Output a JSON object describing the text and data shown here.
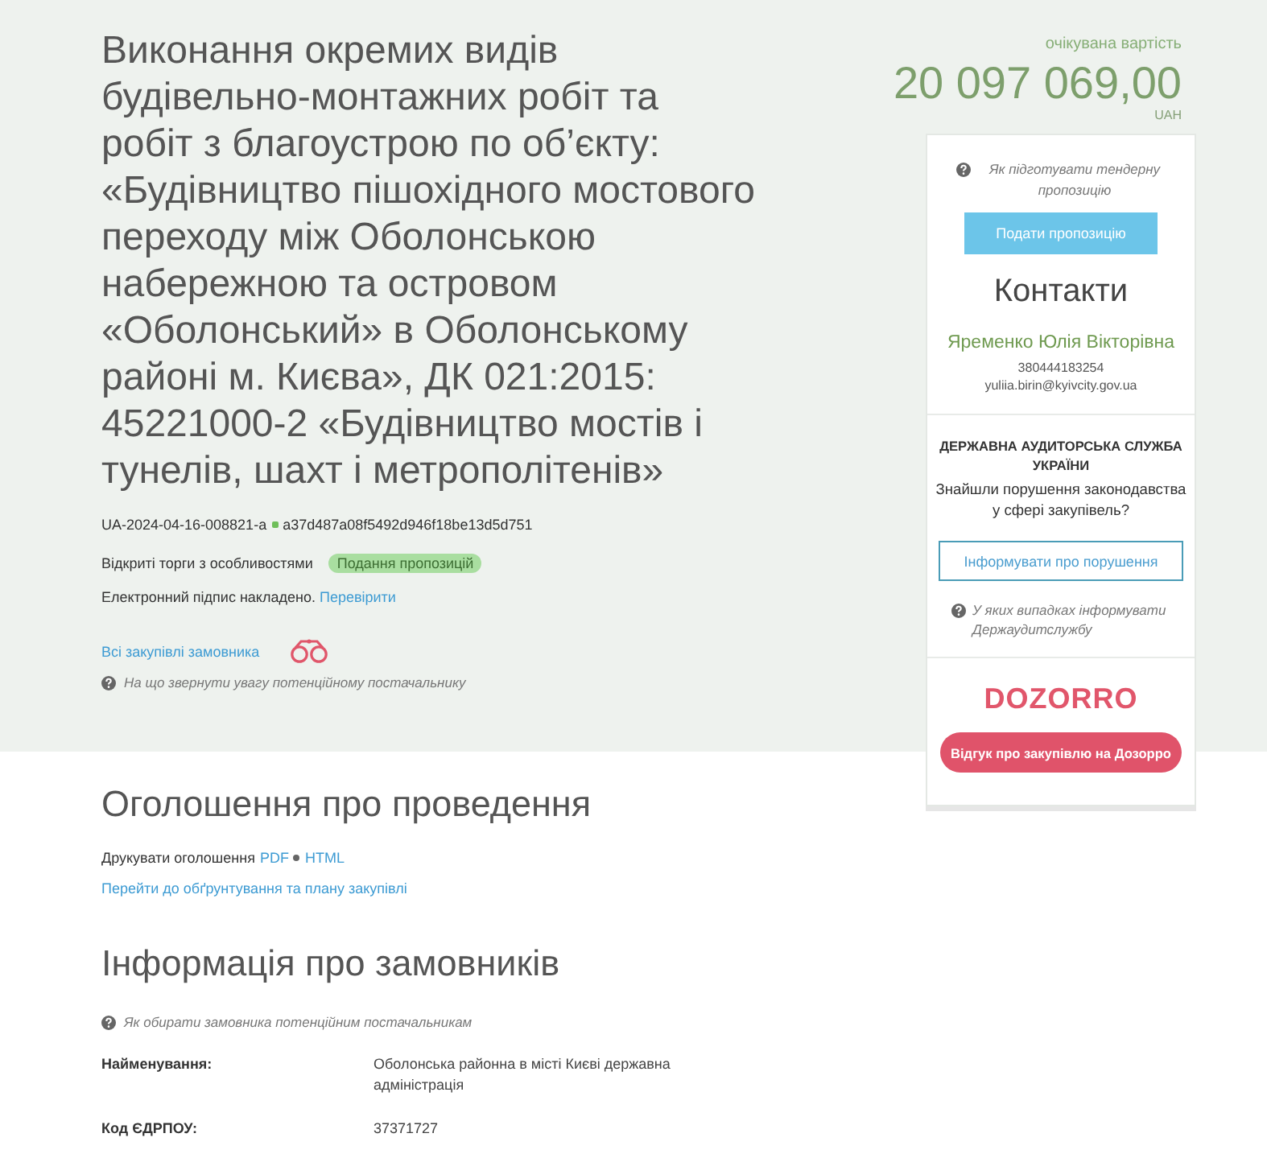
{
  "title": "Виконання окремих видів будівельно-монтажних робіт та робіт з благоустрою по об’єкту: «Будівництво пішохідного мостового переходу між Оболонською набережною та островом «Оболонський» в Оболонському районі м. Києва», ДК 021:2015: 45221000-2 «Будівництво мостів і тунелів, шахт і метрополітенів»",
  "tender_id": "UA-2024-04-16-008821-a",
  "hash": "a37d487a08f5492d946f18be13d5d751",
  "procedure": {
    "type": "Відкриті торги з особливостями",
    "status": "Подання пропозицій"
  },
  "signature": {
    "text": "Електронний підпис накладено.",
    "link": "Перевірити"
  },
  "customer_link": "Всі закупівлі замовника",
  "supplier_hint": "На що звернути увагу потенційному постачальнику",
  "value": {
    "label": "очікувана вартість",
    "amount": "20 097 069,00",
    "currency": "UAH"
  },
  "sidebar": {
    "hint": "Як підготувати тендерну пропозицію",
    "submit_button": "Подати пропозицію",
    "contacts": {
      "heading": "Контакти",
      "name": "Яременко Юлія Вікторівна",
      "phone": "380444183254",
      "email": "yuliia.birin@kyivcity.gov.ua"
    },
    "audit": {
      "heading": "ДЕРЖАВНА АУДИТОРСЬКА СЛУЖБА УКРАЇНИ",
      "question": "Знайшли порушення законодавства у сфері закупівель?",
      "button": "Інформувати про порушення",
      "hint": "У яких випадках інформувати Держаудитслужбу"
    },
    "dozorro": {
      "logo": "DOZORRO",
      "button": "Відгук про закупівлю на Дозорро"
    }
  },
  "announcement": {
    "heading": "Оголошення про проведення",
    "print_label": "Друкувати оголошення",
    "print_links": [
      "PDF",
      "HTML"
    ],
    "plan_link": "Перейти до обґрунтування та плану закупівлі"
  },
  "customers": {
    "heading": "Інформація про замовників",
    "hint": "Як обирати замовника потенційним постачальникам",
    "fields": [
      {
        "label": "Найменування:",
        "value": "Оболонська районна в місті Києві державна адміністрація"
      },
      {
        "label": "Код ЄДРПОУ:",
        "value": "37371727"
      }
    ]
  }
}
